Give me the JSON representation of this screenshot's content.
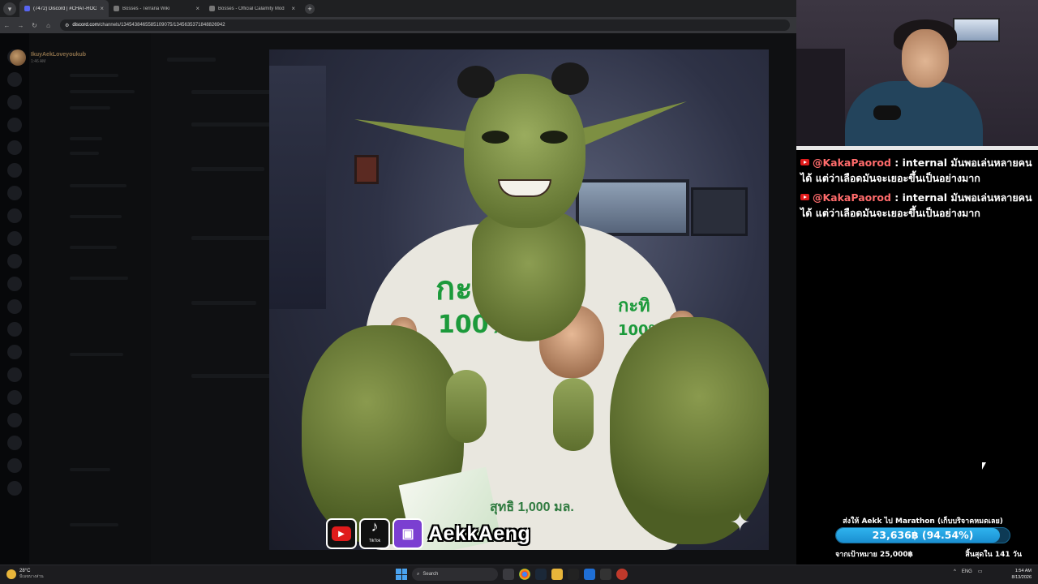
{
  "browser": {
    "tabs": [
      {
        "title": "(7472) Discord | #CHAT-ROOM",
        "active": true
      },
      {
        "title": "Bosses - Terraria Wiki",
        "active": false
      },
      {
        "title": "Bosses - Official Calamity Mod",
        "active": false
      }
    ],
    "url_host": "discord.com",
    "url_path": "/channels/1345438465585109075/1345635371848826942"
  },
  "discord": {
    "uploader_name": "IkuyAekLoveyoukub",
    "uploader_time": "1:46 AM"
  },
  "overlay": {
    "social_handle": "AekkAeng",
    "tiktok_label": "TikTok"
  },
  "artwork": {
    "shirt_text_left": "กะทิ",
    "shirt_text_left_pct": "100%",
    "shirt_text_right": "กะทิ",
    "shirt_text_right_pct": "100%",
    "carton_text": "สุทธิ 1,000 มล."
  },
  "chat": {
    "messages": [
      {
        "user": "@KakaPaorod",
        "text": " : internal มันพอเล่นหลายคนได้ แต่ว่าเลือดมันจะเยอะขึ้นเป็นอย่างมาก"
      },
      {
        "user": "@KakaPaorod",
        "text": " : internal มันพอเล่นหลายคนได้ แต่ว่าเลือดมันจะเยอะขึ้นเป็นอย่างมาก"
      }
    ]
  },
  "goal": {
    "title": "ส่งให้ Aekk ไป Marathon (เก็บบริจาคหมดเลย)",
    "amount_label": "23,636฿ (94.54%)",
    "progress_percent": 94.54,
    "target_label": "จากเป้าหมาย 25,000฿",
    "days_left_label": "สิ้นสุดใน 141 วัน"
  },
  "taskbar": {
    "temperature": "28°C",
    "weather": "มีเมฆบางส่วน",
    "search_placeholder": "Search",
    "language": "ENG",
    "time": "1:54 AM",
    "date": "8/13/2026"
  },
  "colors": {
    "accent_blue": "#1a8fd1",
    "youtube_red": "#e01b1b",
    "twitch_purple": "#7b3fd1",
    "chat_user": "#ff6b6b"
  },
  "icons": [
    "back-icon",
    "forward-icon",
    "reload-icon",
    "home-icon",
    "youtube-icon",
    "tiktok-icon",
    "twitch-icon",
    "sparkle-icon",
    "windows-icon",
    "search-icon",
    "chrome-icon",
    "steam-icon"
  ]
}
